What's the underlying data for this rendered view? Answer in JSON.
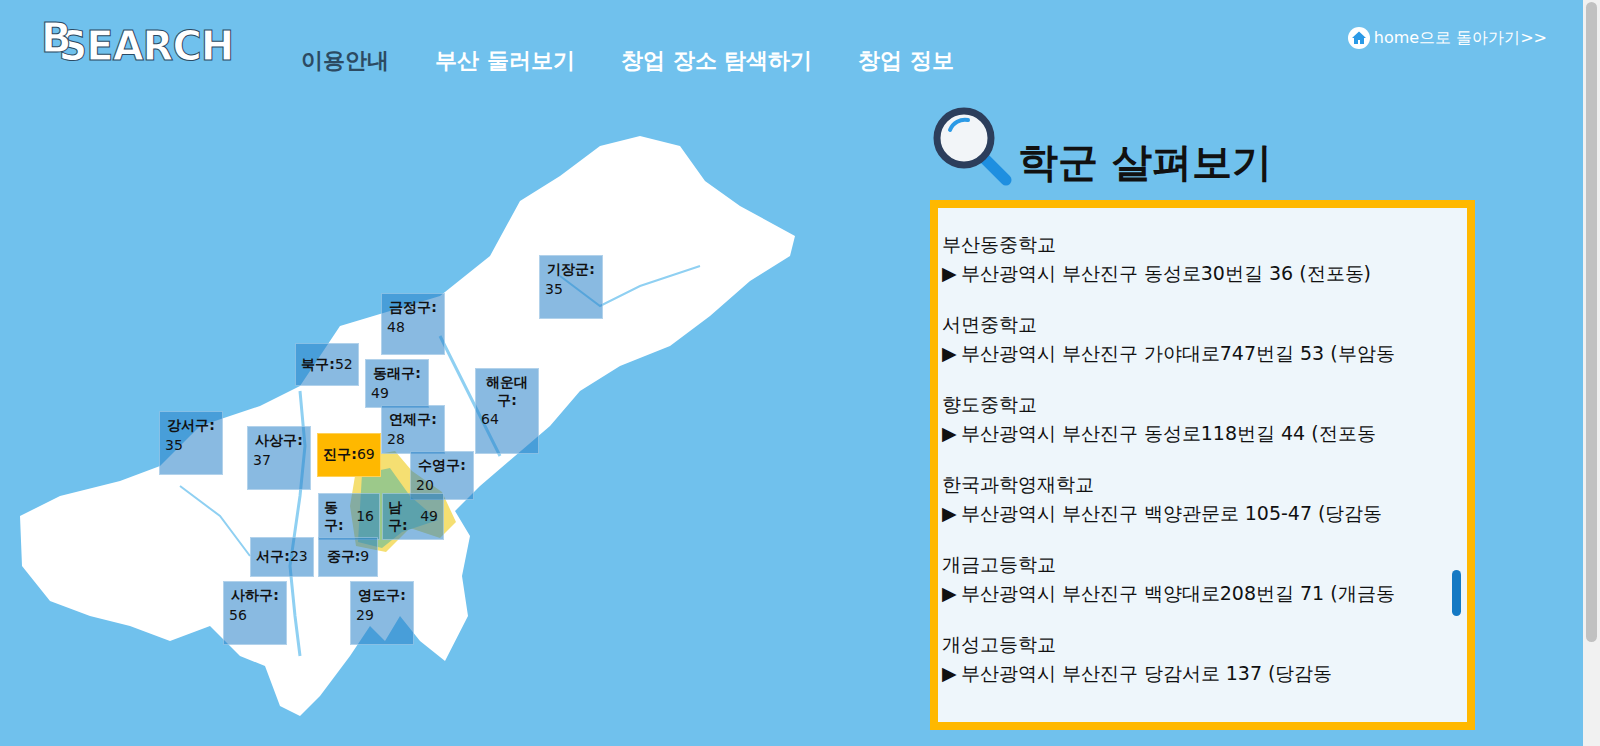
{
  "logo": {
    "first": "B",
    "rest": "SEARCH"
  },
  "nav": [
    {
      "label": "이용안내",
      "selected": true
    },
    {
      "label": "부산 둘러보기",
      "selected": false
    },
    {
      "label": "창업 장소 탐색하기",
      "selected": false
    },
    {
      "label": "창업 정보",
      "selected": false
    }
  ],
  "home_link": {
    "label": "home으로 돌아가기>>"
  },
  "districts": [
    {
      "name": "기장군:",
      "count": "35",
      "selected": false
    },
    {
      "name": "금정구:",
      "count": "48",
      "selected": false
    },
    {
      "name": "북구:",
      "count": "52",
      "selected": false
    },
    {
      "name": "동래구:",
      "count": "49",
      "selected": false
    },
    {
      "name": "해운대구:",
      "count": "64",
      "selected": false
    },
    {
      "name": "연제구:",
      "count": "28",
      "selected": false
    },
    {
      "name": "진구:",
      "count": "69",
      "selected": true
    },
    {
      "name": "강서구:",
      "count": "35",
      "selected": false
    },
    {
      "name": "사상구:",
      "count": "37",
      "selected": false
    },
    {
      "name": "수영구:",
      "count": "20",
      "selected": false
    },
    {
      "name": "동구:",
      "count": "16",
      "selected": false
    },
    {
      "name": "남구:",
      "count": "49",
      "selected": false
    },
    {
      "name": "서구:",
      "count": "23",
      "selected": false
    },
    {
      "name": "중구:",
      "count": "9",
      "selected": false
    },
    {
      "name": "사하구:",
      "count": "56",
      "selected": false
    },
    {
      "name": "영도구:",
      "count": "29",
      "selected": false
    }
  ],
  "panel": {
    "title": "학군 살펴보기",
    "scroll_position": 0.78,
    "schools": [
      {
        "name": "부산동중학교",
        "marker": "▶",
        "address": "부산광역시 부산진구 동성로30번길 36 (전포동)"
      },
      {
        "name": "서면중학교",
        "marker": "▶",
        "address": "부산광역시 부산진구 가야대로747번길 53 (부암동"
      },
      {
        "name": "향도중학교",
        "marker": "▶",
        "address": "부산광역시 부산진구 동성로118번길 44 (전포동"
      },
      {
        "name": "한국과학영재학교",
        "marker": "▶",
        "address": "부산광역시 부산진구 백양관문로 105-47 (당감동"
      },
      {
        "name": "개금고등학교",
        "marker": "▶",
        "address": "부산광역시 부산진구 백양대로208번길 71 (개금동"
      },
      {
        "name": "개성고등학교",
        "marker": "▶",
        "address": "부산광역시 부산진구 당감서로 137 (당감동"
      }
    ]
  }
}
